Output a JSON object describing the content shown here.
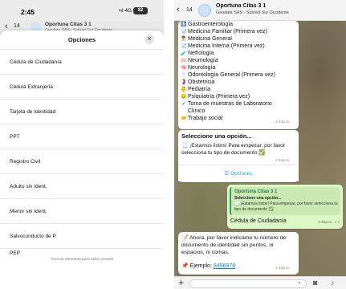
{
  "left": {
    "status": {
      "time": "2:45",
      "signal": "•ıl 4G",
      "battery": "82"
    },
    "background_chat": {
      "title": "Oportuna Citas 3 1",
      "subtitle": "Geodata SAS - Subred Sur Occidente",
      "count": "14"
    },
    "sheet": {
      "title": "Opciones",
      "options": [
        "Cédula de Ciudadanía",
        "Cédula Extranjería",
        "Tarjeta de Identidad",
        "PPT",
        "Registro Civil",
        "Adulto sin Ident.",
        "Menor sin Ident.",
        "Salvoconducto de P.",
        "PEP"
      ],
      "footer": "Toca un elemento para seleccionarlo"
    }
  },
  "right": {
    "header": {
      "back_count": "14",
      "title": "Oportuna Citas 3 1",
      "subtitle": "Geodata SAS - Subred Sur Occidente"
    },
    "specialties": [
      {
        "icon": "🩻",
        "label": "Gastroenterología"
      },
      {
        "icon": "🩺",
        "label": "Medicina Familiar (Primera vez)"
      },
      {
        "icon": "👨‍⚕️",
        "label": "Medicina General"
      },
      {
        "icon": "🩺",
        "label": "Medicina Interna (Primera vez)"
      },
      {
        "icon": "🧪",
        "label": "Nefrología"
      },
      {
        "icon": "🫁",
        "label": "Neumología"
      },
      {
        "icon": "🧠",
        "label": "Neurología"
      },
      {
        "icon": "🦷",
        "label": "Odontología General (Primera vez)"
      },
      {
        "icon": "🤰",
        "label": "Obstetricia"
      },
      {
        "icon": "👶",
        "label": "Pediatría"
      },
      {
        "icon": "😔",
        "label": "Psiquiatría (Primera vez)"
      },
      {
        "icon": "💉",
        "label": "Toma de muestras de Laboratorio"
      },
      {
        "icon": "",
        "label": "Clínico"
      },
      {
        "icon": "🤝",
        "label": "Trabajo social"
      }
    ],
    "specialties_time": "2:44p.m.",
    "select_msg": {
      "heading": "Seleccione una opción...",
      "body": "📃 ¡Estamos listos! Para empezar, por favor selecciona tu tipo de documento ✅",
      "time": "2:44p.m.",
      "options_button": "Opciones"
    },
    "reply_msg": {
      "quote_title": "Oportuna Citas 3 1",
      "quote_heading": "Seleccione una opción...",
      "quote_body": "📃 ¡Estamos listos! Para empezar, por favor selecciona tu tipo de documento ✅",
      "text": "Cédula de Ciudadanía",
      "time": "2:46p.m. ✓✓"
    },
    "doc_msg": {
      "body": "📝 Ahora, por favor indícame tu número de documento de identidad sin puntos, ni espacios, ni comas.",
      "example_label": "📌 Ejemplo:",
      "example_value": "8456978",
      "time": "2:46p.m."
    }
  }
}
